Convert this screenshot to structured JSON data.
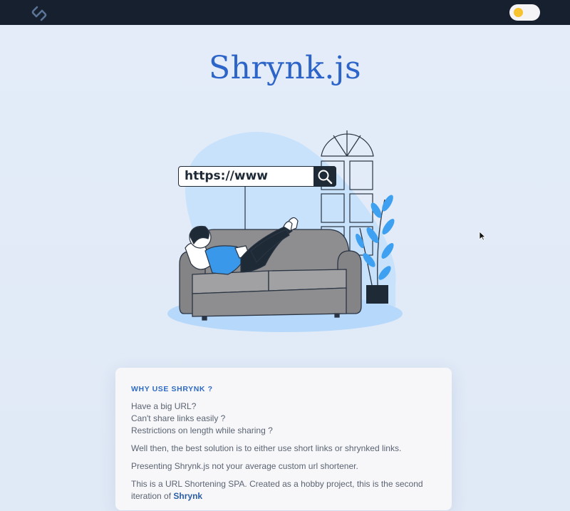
{
  "header": {
    "logo_icon": "link-icon",
    "theme_toggle_icon": "sun-icon"
  },
  "main": {
    "title": "Shrynk.js",
    "illustration": {
      "url_text": "https://www",
      "search_icon": "search-icon"
    }
  },
  "info_card": {
    "heading": "WHY USE SHRYNK ?",
    "questions": [
      "Have a big URL?",
      "Can't share links easily ?",
      "Restrictions on length while sharing ?"
    ],
    "solution": "Well then, the best solution is to either use short links or shrynked links.",
    "presenting": "Presenting Shrynk.js not your average custom url shortener.",
    "about_text": "This is a URL Shortening SPA. Created as a hobby project, this is the second iteration of",
    "about_strong": "Shrynk"
  },
  "colors": {
    "topbar": "#17202e",
    "title": "#2c64c9",
    "accent_blue": "#2f6bc4",
    "page_bg": "#e3ebf6"
  }
}
